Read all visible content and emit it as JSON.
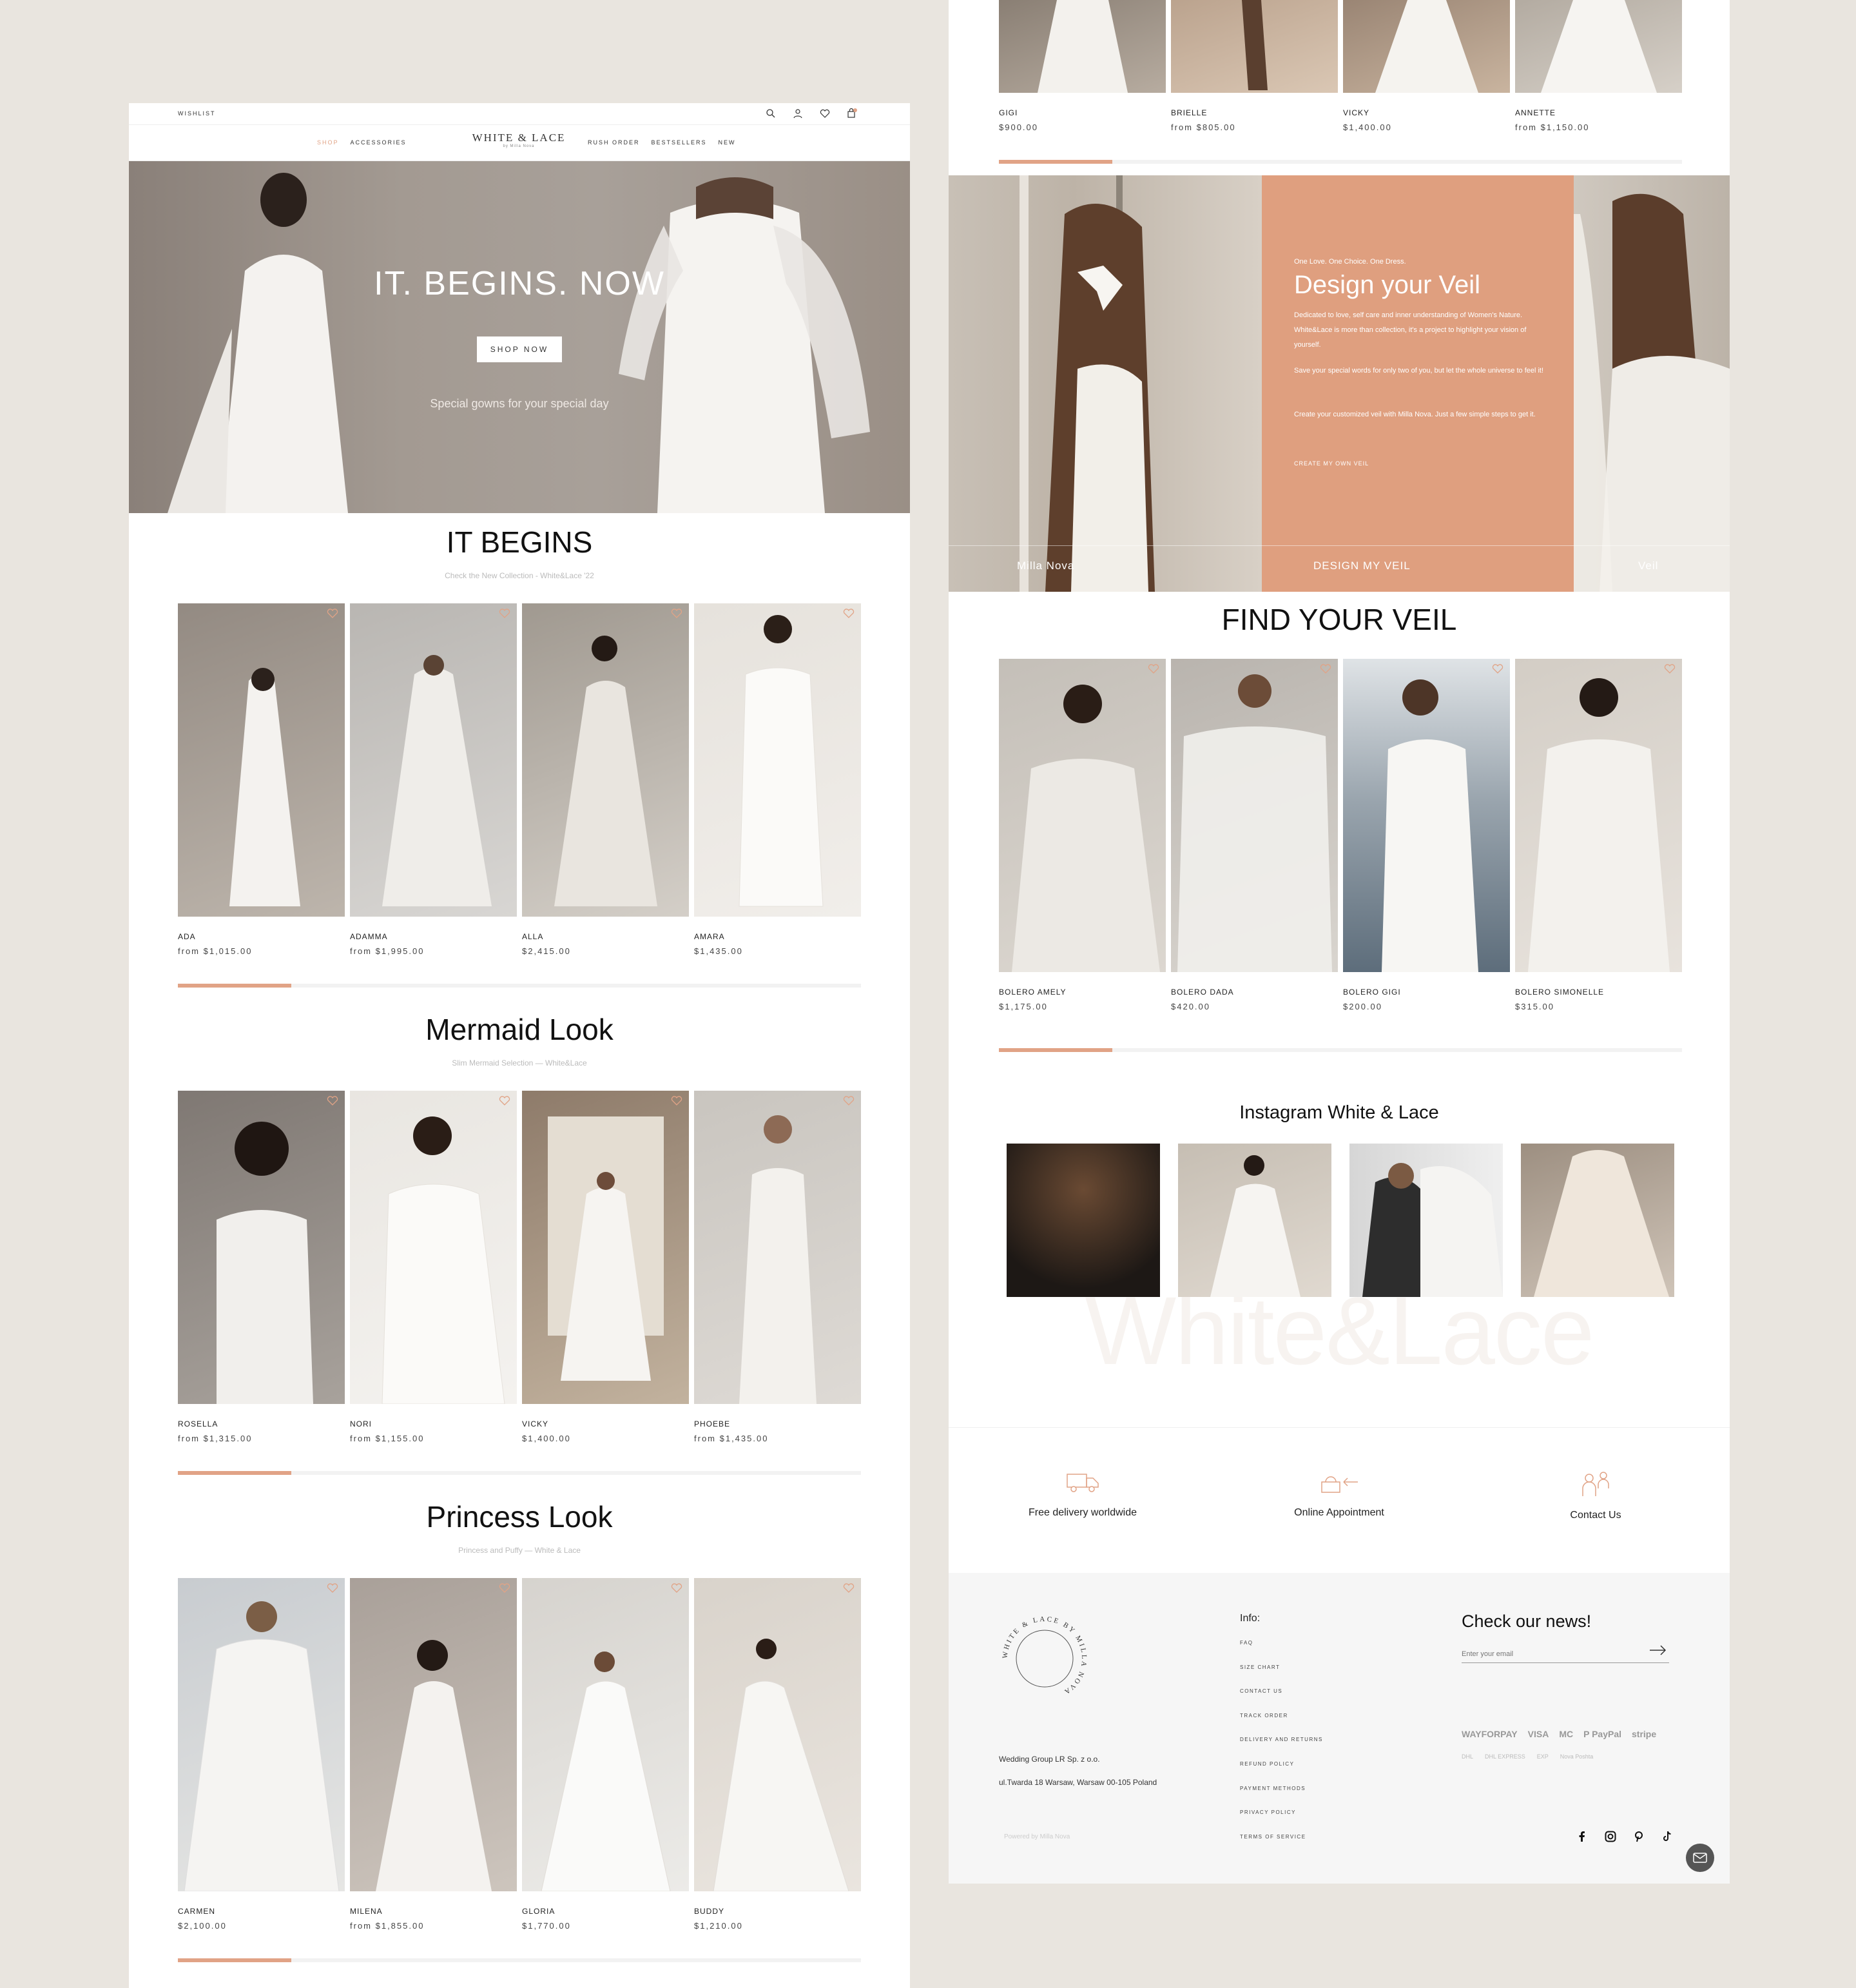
{
  "header": {
    "wishlist": "WISHLIST",
    "nav_left": [
      "SHOP",
      "ACCESSORIES"
    ],
    "nav_right": [
      "RUSH ORDER",
      "BESTSELLERS",
      "NEW"
    ],
    "brand": "WHITE & LACE",
    "brand_sub": "by Milla Nova",
    "icons": [
      "search-icon",
      "account-icon",
      "heart-icon",
      "cart-icon"
    ]
  },
  "hero": {
    "title": "IT. BEGINS. NOW",
    "button": "SHOP NOW",
    "subtitle": "Special gowns for your special day"
  },
  "sections": [
    {
      "title": "IT BEGINS",
      "subtitle": "Check the New Collection - White&Lace '22",
      "products": [
        {
          "name": "ADA",
          "price": "from $1,015.00"
        },
        {
          "name": "ADAMMA",
          "price": "from $1,995.00"
        },
        {
          "name": "ALLA",
          "price": "$2,415.00"
        },
        {
          "name": "AMARA",
          "price": "$1,435.00"
        }
      ]
    },
    {
      "title": "Mermaid Look",
      "subtitle": "Slim Mermaid Selection — White&Lace",
      "products": [
        {
          "name": "ROSELLA",
          "price": "from $1,315.00"
        },
        {
          "name": "NORI",
          "price": "from $1,155.00"
        },
        {
          "name": "VICKY",
          "price": "$1,400.00"
        },
        {
          "name": "PHOEBE",
          "price": "from $1,435.00"
        }
      ]
    },
    {
      "title": "Princess Look",
      "subtitle": "Princess and Puffy — White & Lace",
      "products": [
        {
          "name": "CARMEN",
          "price": "$2,100.00"
        },
        {
          "name": "MILENA",
          "price": "from $1,855.00"
        },
        {
          "name": "GLORIA",
          "price": "$1,770.00"
        },
        {
          "name": "BUDDY",
          "price": "$1,210.00"
        }
      ]
    }
  ],
  "top_products": [
    {
      "name": "GIGI",
      "price": "$900.00"
    },
    {
      "name": "BRIELLE",
      "price": "from $805.00"
    },
    {
      "name": "VICKY",
      "price": "$1,400.00"
    },
    {
      "name": "ANNETTE",
      "price": "from $1,150.00"
    }
  ],
  "veil_banner": {
    "small": "One Love. One Choice. One Dress.",
    "title": "Design your Veil",
    "p1": "Dedicated to love, self care and inner understanding of Women's Nature. White&Lace is more than collection, it's a project to highlight your vision of yourself.",
    "p2": "Save your special words for only two of you, but let the whole universe to feel it!",
    "p3": "Create your customized veil with Milla Nova. Just a few simple steps to get it.",
    "link": "CREATE MY OWN VEIL",
    "label_left": "Milla Nova",
    "label_mid": "DESIGN MY VEIL",
    "label_right": "Veil"
  },
  "find_veil": {
    "title": "FIND YOUR VEIL",
    "products": [
      {
        "name": "BOLERO AMELY",
        "price": "$1,175.00"
      },
      {
        "name": "BOLERO DADA",
        "price": "$420.00"
      },
      {
        "name": "BOLERO GIGI",
        "price": "$200.00"
      },
      {
        "name": "BOLERO SIMONELLE",
        "price": "$315.00"
      }
    ]
  },
  "instagram": {
    "title": "Instagram White & Lace",
    "watermark": "White&Lace"
  },
  "features": [
    {
      "label": "Free delivery worldwide",
      "icon": "truck-icon"
    },
    {
      "label": "Online Appointment",
      "icon": "appointment-icon"
    },
    {
      "label": "Contact Us",
      "icon": "contact-icon"
    }
  ],
  "footer": {
    "seal_text": "WHITE & LACE BY MILLA NOVA",
    "address1": "Wedding Group LR Sp. z o.o.",
    "address2": "ul.Twarda 18 Warsaw, Warsaw 00-105 Poland",
    "powered": "Powered by Milla Nova",
    "info_title": "Info:",
    "links": [
      "FAQ",
      "SIZE CHART",
      "CONTACT US",
      "TRACK ORDER",
      "DELIVERY AND RETURNS",
      "REFUND POLICY",
      "PAYMENT METHODS",
      "PRIVACY POLICY",
      "TERMS OF SERVICE"
    ],
    "news_title": "Check our news!",
    "email_placeholder": "Enter your email",
    "payments": [
      "WAYFORPAY",
      "VISA",
      "MC",
      "P PayPal",
      "stripe"
    ],
    "shipping": [
      "DHL",
      "DHL EXPRESS",
      "EXP",
      "Nova Poshta"
    ],
    "social": [
      "facebook-icon",
      "instagram-icon",
      "pinterest-icon",
      "tiktok-icon"
    ]
  }
}
